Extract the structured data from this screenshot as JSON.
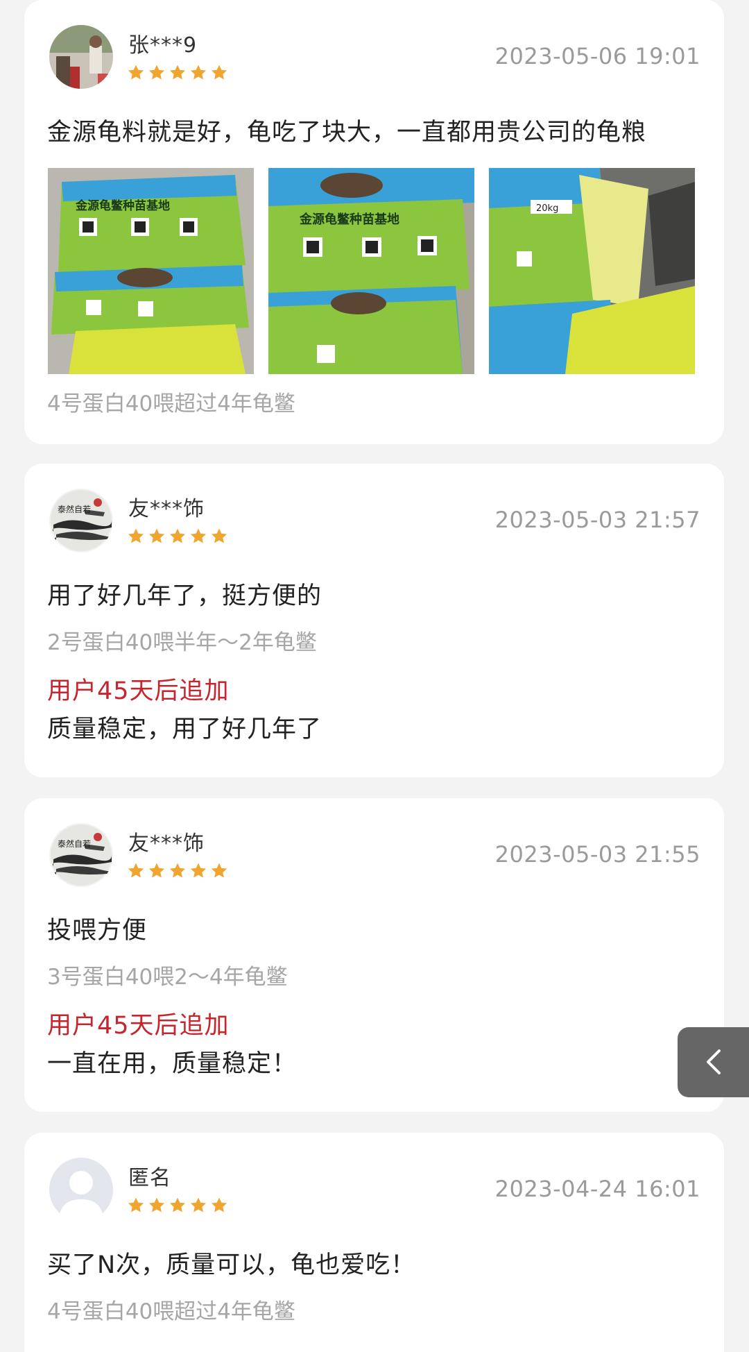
{
  "reviews": [
    {
      "username": "张***9",
      "rating": 5,
      "date": "2023-05-06 19:01",
      "comment": "金源龟料就是好，龟吃了块大，一直都用贵公司的龟粮",
      "photos": [
        {
          "label": "金源龟鳖种苗基地"
        },
        {
          "label": "金源龟鳖种苗基地"
        },
        {
          "label": "20kg"
        }
      ],
      "spec": "4号蛋白40喂超过4年龟鳖"
    },
    {
      "username": "友***饰",
      "rating": 5,
      "date": "2023-05-03 21:57",
      "comment": "用了好几年了，挺方便的",
      "spec": "2号蛋白40喂半年～2年龟鳖",
      "followup_label": "用户45天后追加",
      "followup_text": "质量稳定，用了好几年了"
    },
    {
      "username": "友***饰",
      "rating": 5,
      "date": "2023-05-03 21:55",
      "comment": "投喂方便",
      "spec": "3号蛋白40喂2～4年龟鳖",
      "followup_label": "用户45天后追加",
      "followup_text": "一直在用，质量稳定！"
    },
    {
      "username": "匿名",
      "rating": 5,
      "date": "2023-04-24 16:01",
      "comment": "买了N次，质量可以，龟也爱吃！",
      "spec": "4号蛋白40喂超过4年龟鳖"
    }
  ],
  "icons": {
    "star": "star-icon",
    "back": "chevron-left-icon"
  },
  "colors": {
    "star": "#f0a530",
    "followup": "#c8242d",
    "muted": "#9a9a9a",
    "page_bg": "#f3f3f3"
  }
}
